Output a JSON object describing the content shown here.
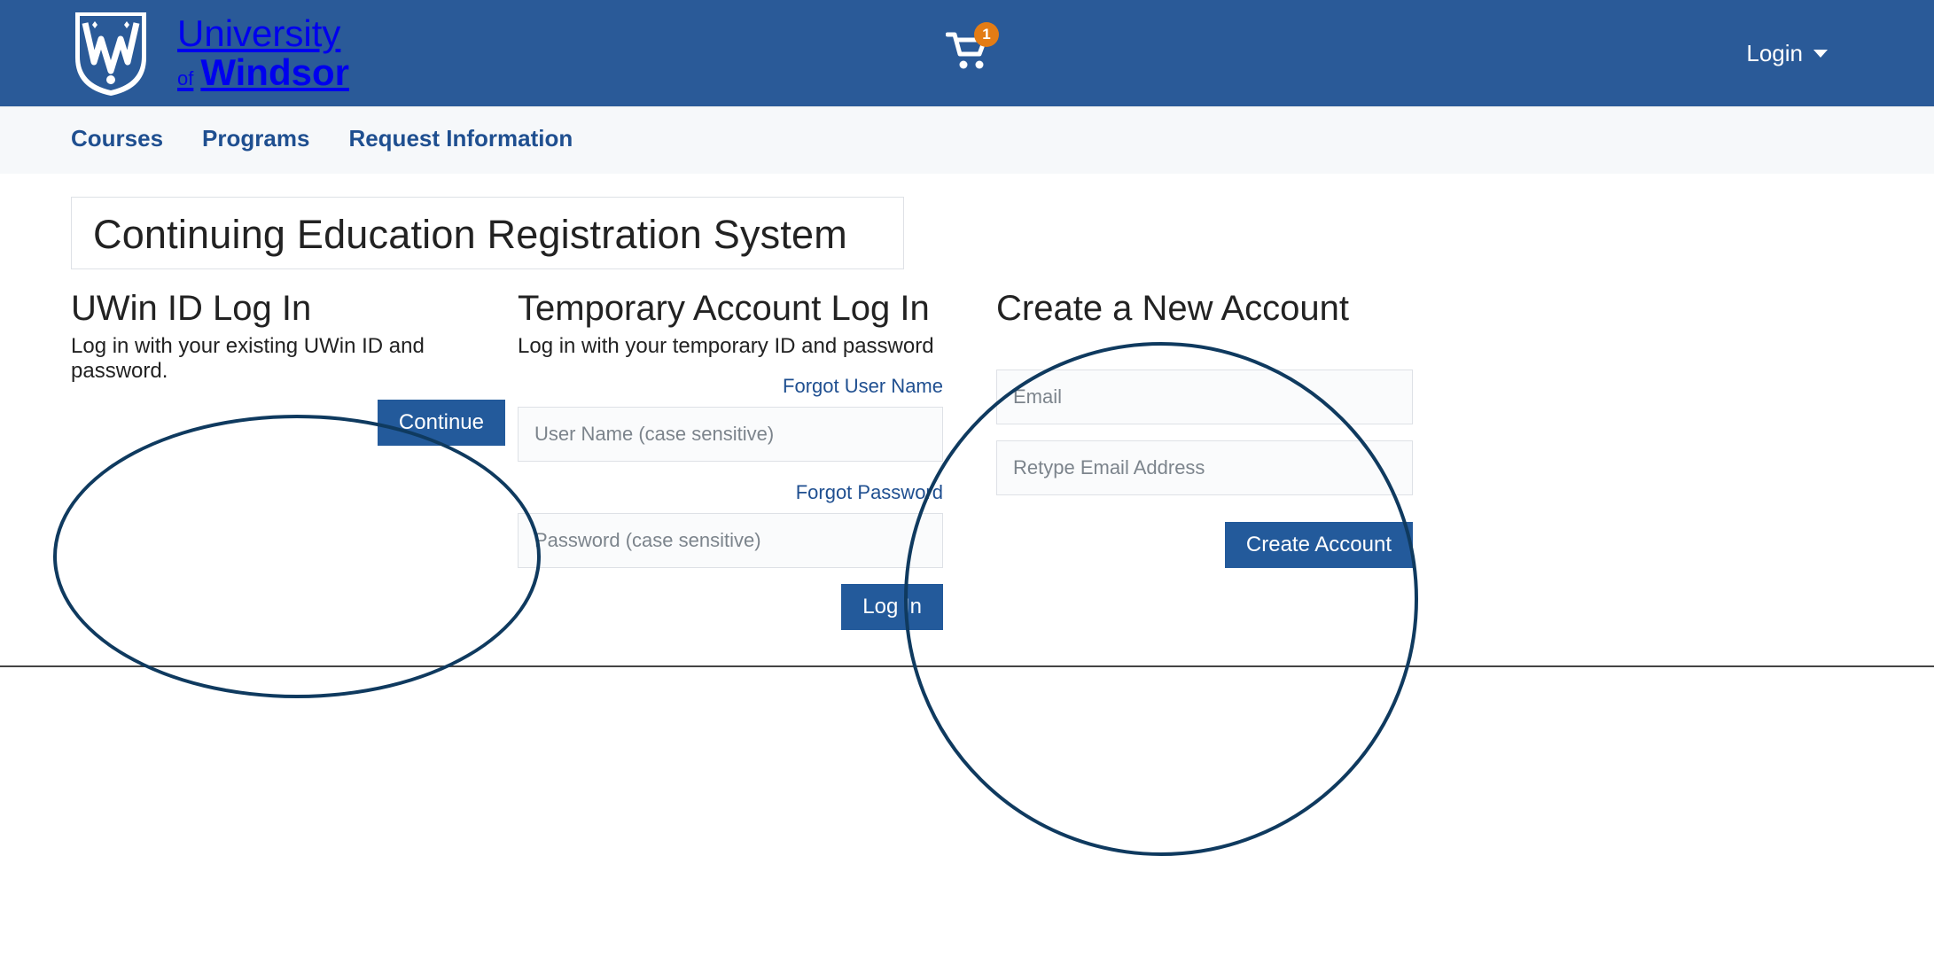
{
  "header": {
    "brand_line1": "University",
    "brand_of": "of",
    "brand_name": "Windsor",
    "cart_count": "1",
    "login_label": "Login"
  },
  "nav": {
    "items": [
      {
        "label": "Courses"
      },
      {
        "label": "Programs"
      },
      {
        "label": "Request Information"
      }
    ]
  },
  "page": {
    "title": "Continuing Education Registration System"
  },
  "uwin": {
    "heading": "UWin ID Log In",
    "subtext": "Log in with your existing UWin ID and password.",
    "continue_label": "Continue"
  },
  "temp": {
    "heading": "Temporary Account Log In",
    "subtext": "Log in with your temporary ID and password",
    "forgot_user_label": "Forgot User Name",
    "username_placeholder": "User Name (case sensitive)",
    "forgot_pw_label": "Forgot Password",
    "password_placeholder": "Password (case sensitive)",
    "login_label": "Log In"
  },
  "create": {
    "heading": "Create a New Account",
    "email_placeholder": "Email",
    "retype_placeholder": "Retype Email Address",
    "create_label": "Create Account"
  },
  "colors": {
    "primary": "#2a5a98",
    "accent_orange": "#e37c15",
    "annotation_navy": "#0f3a5f"
  }
}
